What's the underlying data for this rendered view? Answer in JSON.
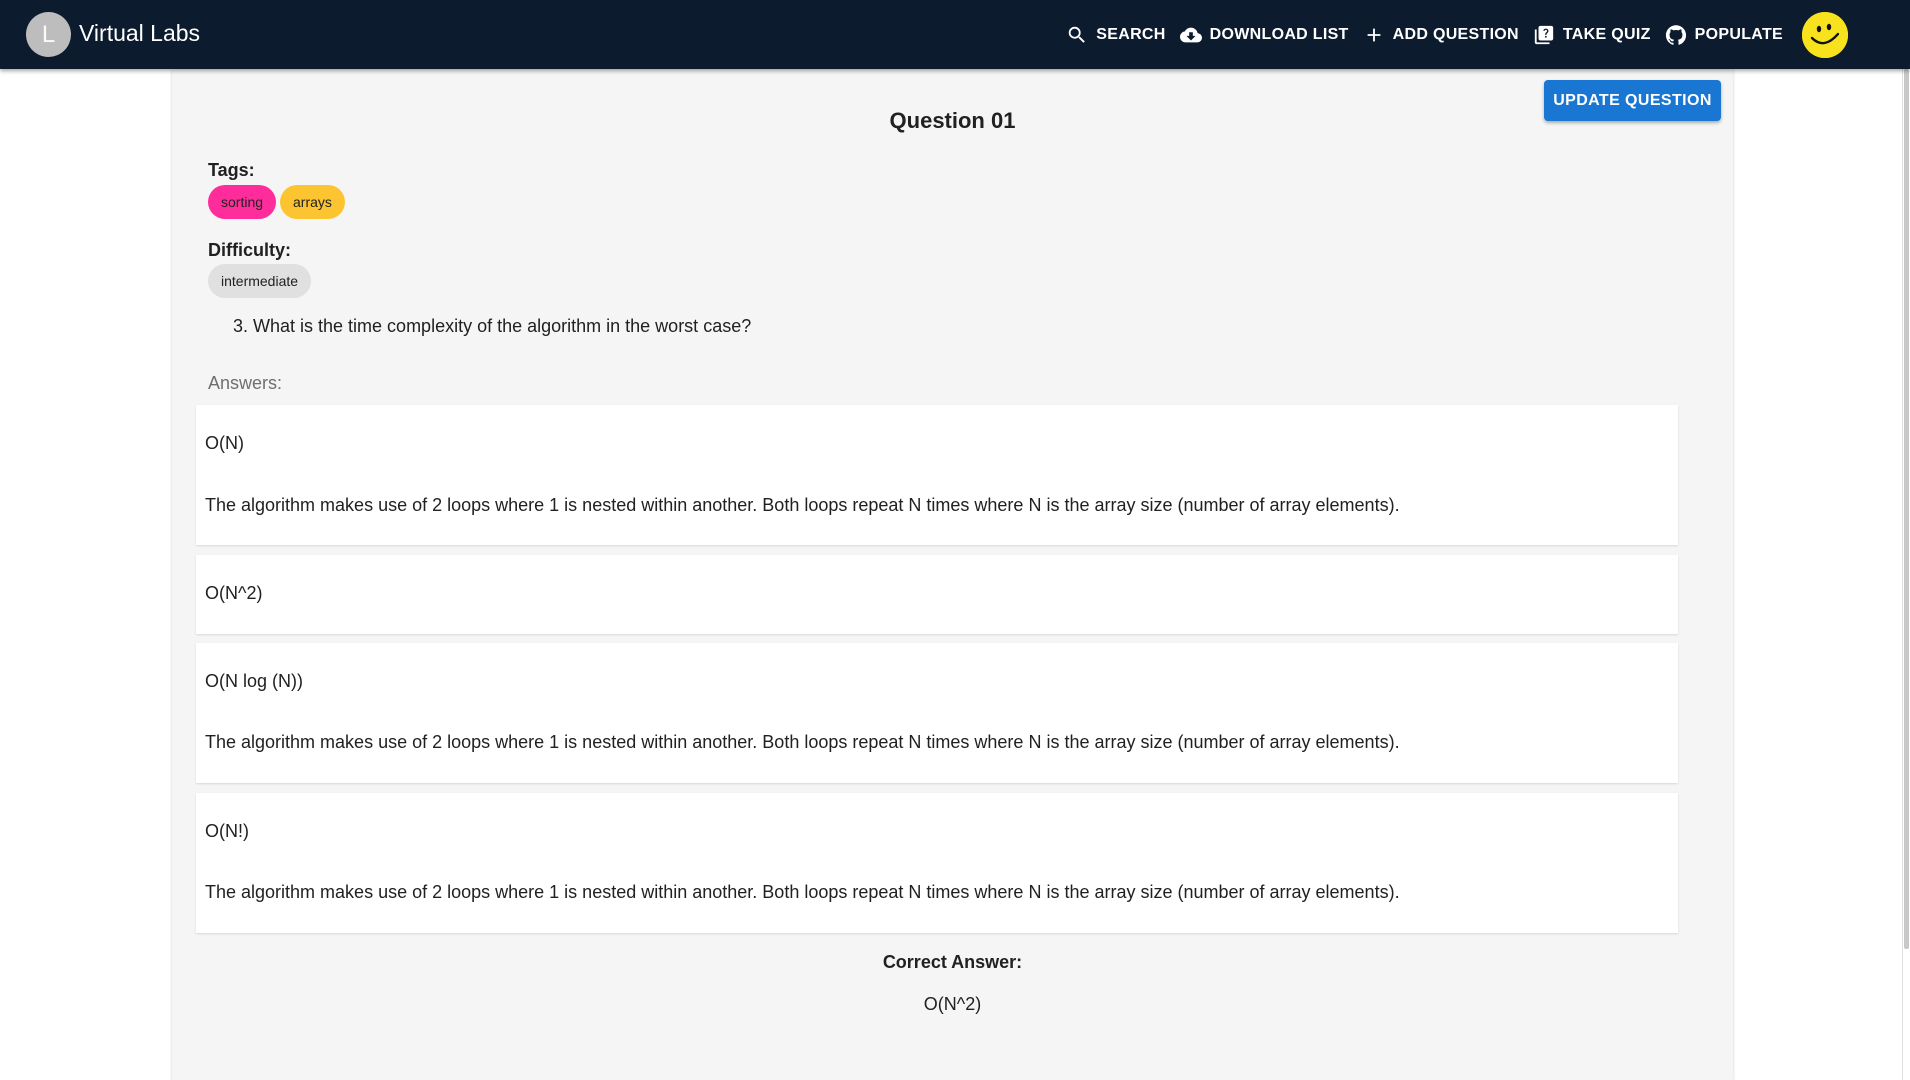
{
  "app": {
    "title": "Virtual Labs",
    "avatar_letter": "L"
  },
  "nav": {
    "items": [
      {
        "label": "Search",
        "icon": "search-icon"
      },
      {
        "label": "Download List",
        "icon": "cloud-download-icon"
      },
      {
        "label": "Add Question",
        "icon": "plus-icon"
      },
      {
        "label": "Take Quiz",
        "icon": "quiz-icon"
      },
      {
        "label": "Populate",
        "icon": "github-icon"
      }
    ],
    "user_avatar_icon": "smiley-face-icon"
  },
  "toolbar": {
    "update_label": "Update Question"
  },
  "question": {
    "title": "Question 01",
    "tags_label": "Tags:",
    "tags": [
      {
        "label": "sorting",
        "color": "#ff2d9b"
      },
      {
        "label": "arrays",
        "color": "#fcc431"
      }
    ],
    "difficulty_label": "Difficulty:",
    "difficulty": {
      "label": "intermediate",
      "color": "#e0e0e0"
    },
    "text": "3. What is the time complexity of the algorithm in the worst case?",
    "answers_label": "Answers:",
    "answers": [
      {
        "option": "O(N)",
        "explanation": "The algorithm makes use of 2 loops where 1 is nested within another. Both loops repeat N times where N is the array size (number of array elements)."
      },
      {
        "option": "O(N^2)",
        "explanation": ""
      },
      {
        "option": "O(N log (N))",
        "explanation": "The algorithm makes use of 2 loops where 1 is nested within another. Both loops repeat N times where N is the array size (number of array elements)."
      },
      {
        "option": "O(N!)",
        "explanation": "The algorithm makes use of 2 loops where 1 is nested within another. Both loops repeat N times where N is the array size (number of array elements)."
      }
    ],
    "correct_label": "Correct Answer:",
    "correct_value": "O(N^2)"
  },
  "colors": {
    "appbar": "#0d1b2e",
    "primary_button": "#1976d2",
    "avatar_yellow": "#f7e21d"
  }
}
